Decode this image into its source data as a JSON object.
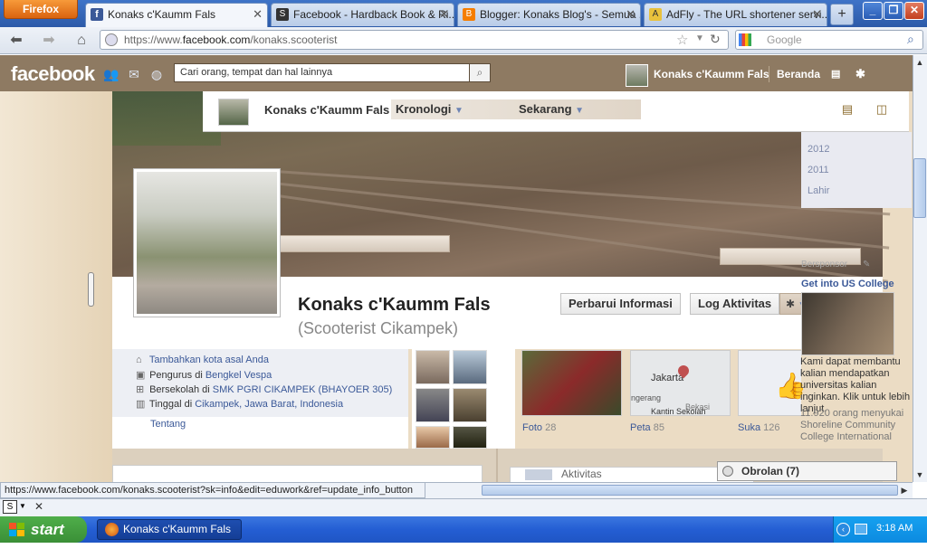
{
  "browser": {
    "menu_button": "Firefox",
    "tabs": [
      {
        "title": "Konaks c'Kaumm Fals",
        "icon": "facebook-favicon",
        "active": true
      },
      {
        "title": "Facebook - Hardback Book & Ri...",
        "icon": "scribd-favicon",
        "active": false
      },
      {
        "title": "Blogger: Konaks Blog's - Semua ...",
        "icon": "blogger-favicon",
        "active": false
      },
      {
        "title": "AdFly - The URL shortener servi...",
        "icon": "adfly-favicon",
        "active": false
      }
    ],
    "new_tab": "+",
    "url_prefix": "https://www.",
    "url_domain": "facebook.com",
    "url_path": "/konaks.scooterist",
    "search_placeholder": "Google",
    "status_url": "https://www.facebook.com/konaks.scooterist?sk=info&edit=eduwork&ref=update_info_button"
  },
  "facebook": {
    "logo": "facebook",
    "search_placeholder": "Cari orang, tempat dan hal lainnya",
    "user_name": "Konaks c'Kaumm Fals",
    "home_label": "Beranda",
    "timeline_name": "Konaks c'Kaumm Fals",
    "kronologi": "Kronologi",
    "sekarang": "Sekarang",
    "years": [
      "2012",
      "2011",
      "Lahir"
    ],
    "profile_name": "Konaks c'Kaumm Fals",
    "profile_subtitle": "(Scooterist Cikampek)",
    "update_info": "Perbarui Informasi",
    "activity_log": "Log Aktivitas",
    "details": [
      {
        "icon": "home-icon",
        "prefix": "",
        "link": "Tambahkan kota asal Anda"
      },
      {
        "icon": "briefcase-icon",
        "prefix": "Pengurus di ",
        "link": "Bengkel Vespa"
      },
      {
        "icon": "school-icon",
        "prefix": "Bersekolah di ",
        "link": "SMK PGRI CIKAMPEK (BHAYOER 305)"
      },
      {
        "icon": "building-icon",
        "prefix": "Tinggal di ",
        "link": "Cikampek, Jawa Barat, Indonesia"
      }
    ],
    "about": "Tentang",
    "tiles": [
      {
        "label": "Foto",
        "count": "28"
      },
      {
        "label": "Peta",
        "count": "85"
      },
      {
        "label": "Suka",
        "count": "126"
      }
    ],
    "map_labels": {
      "city": "Jakarta",
      "left": "ngerang",
      "spot": "Kantin Sekolah",
      "right": "Bekasi"
    },
    "sponsor_label": "Bersponsor",
    "ad_title": "Get into US College",
    "ad_text": "Kami dapat membantu kalian mendapatkan universitas kalian inginkan. Klik untuk lebih lanjut.",
    "ad_likes": "11.920 orang menyukai Shoreline Community College International",
    "activity_label": "Aktivitas",
    "chat": "Obrolan (7)"
  },
  "taskbar": {
    "start": "start",
    "item": "Konaks c'Kaumm Fals ...",
    "clock": "3:18 AM"
  }
}
